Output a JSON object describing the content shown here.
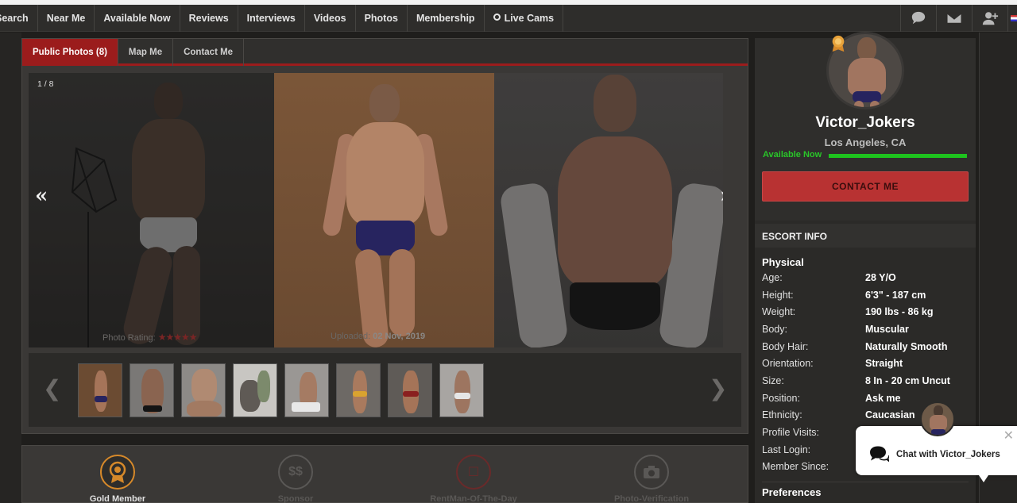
{
  "nav": {
    "items": [
      "Search",
      "Near Me",
      "Available Now",
      "Reviews",
      "Interviews",
      "Videos",
      "Photos",
      "Membership",
      "Live Cams"
    ],
    "icons": [
      "chat-icon",
      "mail-icon",
      "user-add-icon"
    ]
  },
  "tabs": [
    "Public Photos (8)",
    "Map Me",
    "Contact Me"
  ],
  "gallery": {
    "counter": "1 / 8",
    "rating_label": "Photo Rating:",
    "stars": "★★★★★",
    "uploaded_label": "Uploaded:",
    "uploaded_date": "02 Nov, 2019",
    "prev": "«",
    "next": "»",
    "thumb_prev": "❮",
    "thumb_next": "❯"
  },
  "badges": [
    "Gold Member",
    "Sponsor",
    "RentMan-Of-The-Day",
    "Photo-Verification"
  ],
  "profile": {
    "name": "Victor_Jokers",
    "location": "Los Angeles, CA",
    "availability": "Available Now",
    "contact_button": "CONTACT ME",
    "info_header": "ESCORT INFO",
    "physical_title": "Physical",
    "rows": [
      {
        "k": "Age:",
        "v": "28 Y/O"
      },
      {
        "k": "Height:",
        "v": "6'3\" - 187 cm"
      },
      {
        "k": "Weight:",
        "v": "190 lbs - 86 kg"
      },
      {
        "k": "Body:",
        "v": "Muscular"
      },
      {
        "k": "Body Hair:",
        "v": "Naturally Smooth"
      },
      {
        "k": "Orientation:",
        "v": "Straight"
      },
      {
        "k": "Size:",
        "v": "8 In - 20 cm Uncut"
      },
      {
        "k": "Position:",
        "v": "Ask me"
      },
      {
        "k": "Ethnicity:",
        "v": "Caucasian"
      },
      {
        "k": "Profile Visits:",
        "v": ""
      },
      {
        "k": "Last Login:",
        "v": ""
      },
      {
        "k": "Member Since:",
        "v": ""
      }
    ],
    "preferences_title": "Preferences"
  },
  "chat": {
    "label": "Chat with Victor_Jokers",
    "close": "✕"
  },
  "colors": {
    "accent_red": "#9b1c1c",
    "button_red": "#b83232",
    "available_green": "#1ec21e",
    "gold": "#d6892a"
  }
}
